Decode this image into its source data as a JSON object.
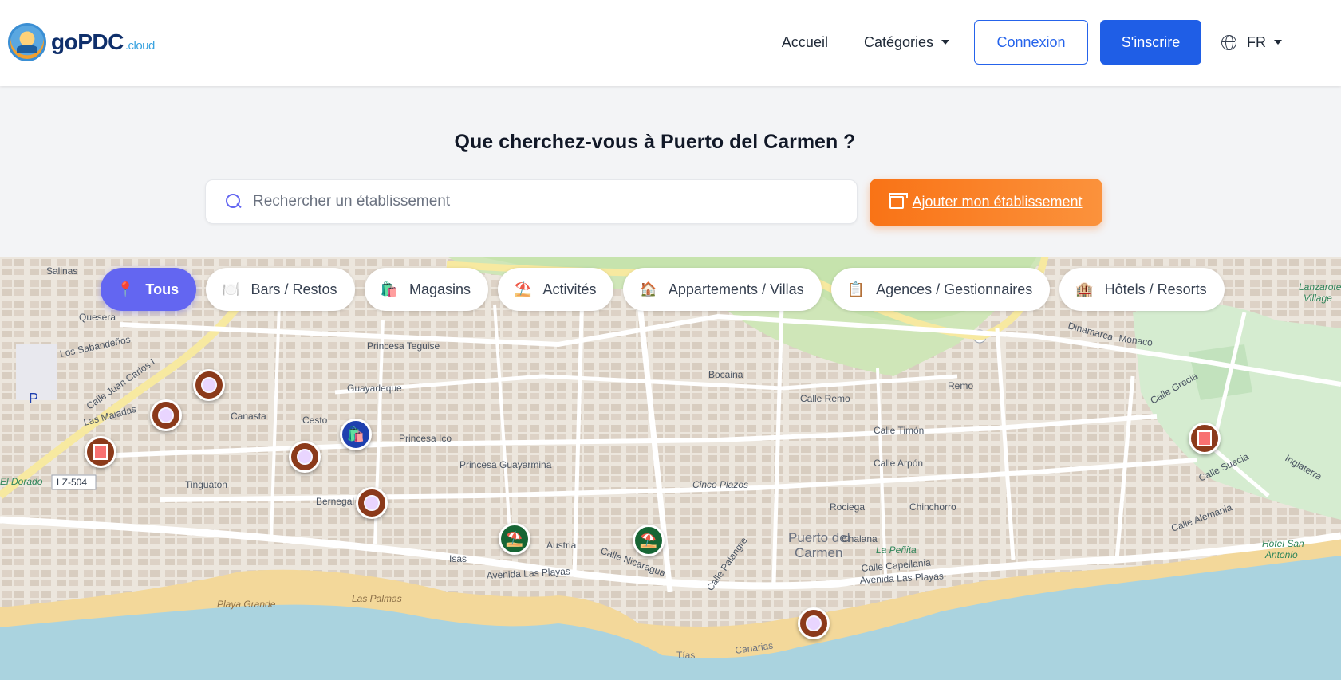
{
  "header": {
    "logo_text": "goPDC",
    "logo_tld": ".cloud",
    "nav": {
      "home_label": "Accueil",
      "categories_label": "Catégories",
      "login_label": "Connexion",
      "signup_label": "S'inscrire",
      "language_label": "FR"
    }
  },
  "hero": {
    "title": "Que cherchez-vous à Puerto del Carmen ?",
    "search_placeholder": "Rechercher un établissement",
    "search_value": "",
    "add_button_label": "Ajouter mon établissement"
  },
  "filters": [
    {
      "label": "Tous",
      "icon": "pin-icon",
      "active": true
    },
    {
      "label": "Bars / Restos",
      "icon": "plate-icon",
      "active": false
    },
    {
      "label": "Magasins",
      "icon": "shopping-bag-icon",
      "active": false
    },
    {
      "label": "Activités",
      "icon": "beach-umbrella-icon",
      "active": false
    },
    {
      "label": "Appartements / Villas",
      "icon": "house-icon",
      "active": false
    },
    {
      "label": "Agences / Gestionnaires",
      "icon": "clipboard-icon",
      "active": false
    },
    {
      "label": "Hôtels / Resorts",
      "icon": "hotel-icon",
      "active": false
    }
  ],
  "map": {
    "labels": {
      "town": "Puerto del",
      "town2": "Carmen",
      "beach": "Playa Grande",
      "road_code": "LZ-504",
      "avenida": "Avenida Las Playas",
      "avenida2": "Avenida Las Playas",
      "princesa_teguise": "Princesa Teguise",
      "princesa_ico": "Princesa Ico",
      "princesa_guayarmina": "Princesa Guayarmina",
      "calle_juan_carlos": "Calle Juan Carlos I",
      "calle_timon": "Calle Timón",
      "calle_arpon": "Calle Arpón",
      "calle_remo": "Calle Remo",
      "rociega": "Rociega",
      "chinchorro": "Chinchorro",
      "chalana": "Chalana",
      "cinco_plazos": "Cinco Plazos",
      "la_penita": "La Peñita",
      "hotel_san_antonio": "Hotel San",
      "hotel_san_antonio2": "Antonio",
      "lanzarote_village": "Lanzarote",
      "lanzarote_village2": "Village",
      "calle_grecia": "Calle Grecia",
      "calle_suecia": "Calle Suecia",
      "austria": "Austria",
      "isas": "Isas",
      "bernegal": "Bernegal",
      "tinguaton": "Tinguaton",
      "canasta": "Canasta",
      "cesto": "Cesto",
      "guayadeque": "Guayadeque",
      "quesera": "Quesera",
      "salinas": "Salinas",
      "los_sabandenos": "Los Sabandeños",
      "las_majadas": "Las Majadas",
      "las_palmas": "Las Palmas",
      "tias": "Tías",
      "canarias": "Canarias",
      "remo": "Remo",
      "bocaina": "Bocaina",
      "dinamarca": "Dinamarca",
      "monaco": "Monaco",
      "el_dorado": "El Dorado",
      "calle_nicaragua": "Calle Nicaragua",
      "calle_palangre": "Calle Palangre",
      "calle_capellania": "Calle Capellania",
      "calle_alemania": "Calle Alemania",
      "ingiaterra": "Inglaterra",
      "parking": "P"
    }
  }
}
